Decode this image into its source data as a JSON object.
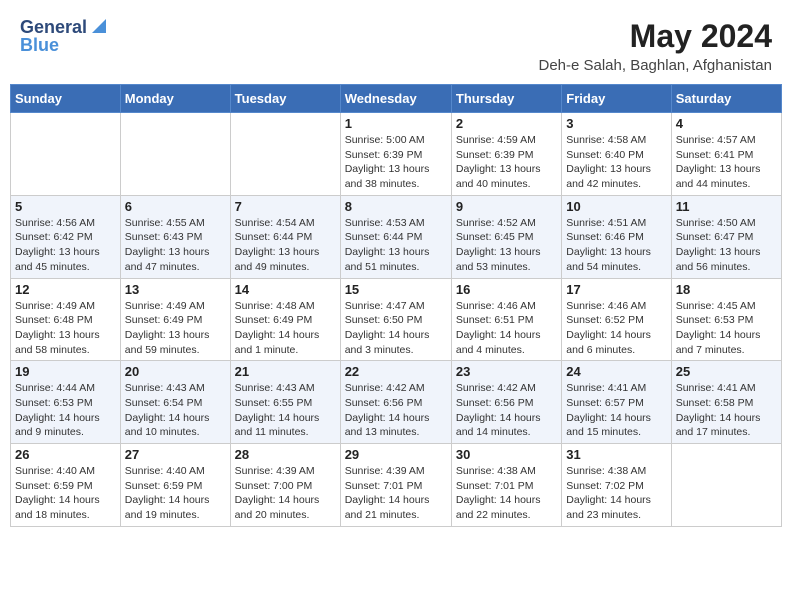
{
  "header": {
    "logo_line1": "General",
    "logo_line2": "Blue",
    "month": "May 2024",
    "location": "Deh-e Salah, Baghlan, Afghanistan"
  },
  "weekdays": [
    "Sunday",
    "Monday",
    "Tuesday",
    "Wednesday",
    "Thursday",
    "Friday",
    "Saturday"
  ],
  "weeks": [
    [
      {
        "day": "",
        "info": ""
      },
      {
        "day": "",
        "info": ""
      },
      {
        "day": "",
        "info": ""
      },
      {
        "day": "1",
        "info": "Sunrise: 5:00 AM\nSunset: 6:39 PM\nDaylight: 13 hours\nand 38 minutes."
      },
      {
        "day": "2",
        "info": "Sunrise: 4:59 AM\nSunset: 6:39 PM\nDaylight: 13 hours\nand 40 minutes."
      },
      {
        "day": "3",
        "info": "Sunrise: 4:58 AM\nSunset: 6:40 PM\nDaylight: 13 hours\nand 42 minutes."
      },
      {
        "day": "4",
        "info": "Sunrise: 4:57 AM\nSunset: 6:41 PM\nDaylight: 13 hours\nand 44 minutes."
      }
    ],
    [
      {
        "day": "5",
        "info": "Sunrise: 4:56 AM\nSunset: 6:42 PM\nDaylight: 13 hours\nand 45 minutes."
      },
      {
        "day": "6",
        "info": "Sunrise: 4:55 AM\nSunset: 6:43 PM\nDaylight: 13 hours\nand 47 minutes."
      },
      {
        "day": "7",
        "info": "Sunrise: 4:54 AM\nSunset: 6:44 PM\nDaylight: 13 hours\nand 49 minutes."
      },
      {
        "day": "8",
        "info": "Sunrise: 4:53 AM\nSunset: 6:44 PM\nDaylight: 13 hours\nand 51 minutes."
      },
      {
        "day": "9",
        "info": "Sunrise: 4:52 AM\nSunset: 6:45 PM\nDaylight: 13 hours\nand 53 minutes."
      },
      {
        "day": "10",
        "info": "Sunrise: 4:51 AM\nSunset: 6:46 PM\nDaylight: 13 hours\nand 54 minutes."
      },
      {
        "day": "11",
        "info": "Sunrise: 4:50 AM\nSunset: 6:47 PM\nDaylight: 13 hours\nand 56 minutes."
      }
    ],
    [
      {
        "day": "12",
        "info": "Sunrise: 4:49 AM\nSunset: 6:48 PM\nDaylight: 13 hours\nand 58 minutes."
      },
      {
        "day": "13",
        "info": "Sunrise: 4:49 AM\nSunset: 6:49 PM\nDaylight: 13 hours\nand 59 minutes."
      },
      {
        "day": "14",
        "info": "Sunrise: 4:48 AM\nSunset: 6:49 PM\nDaylight: 14 hours\nand 1 minute."
      },
      {
        "day": "15",
        "info": "Sunrise: 4:47 AM\nSunset: 6:50 PM\nDaylight: 14 hours\nand 3 minutes."
      },
      {
        "day": "16",
        "info": "Sunrise: 4:46 AM\nSunset: 6:51 PM\nDaylight: 14 hours\nand 4 minutes."
      },
      {
        "day": "17",
        "info": "Sunrise: 4:46 AM\nSunset: 6:52 PM\nDaylight: 14 hours\nand 6 minutes."
      },
      {
        "day": "18",
        "info": "Sunrise: 4:45 AM\nSunset: 6:53 PM\nDaylight: 14 hours\nand 7 minutes."
      }
    ],
    [
      {
        "day": "19",
        "info": "Sunrise: 4:44 AM\nSunset: 6:53 PM\nDaylight: 14 hours\nand 9 minutes."
      },
      {
        "day": "20",
        "info": "Sunrise: 4:43 AM\nSunset: 6:54 PM\nDaylight: 14 hours\nand 10 minutes."
      },
      {
        "day": "21",
        "info": "Sunrise: 4:43 AM\nSunset: 6:55 PM\nDaylight: 14 hours\nand 11 minutes."
      },
      {
        "day": "22",
        "info": "Sunrise: 4:42 AM\nSunset: 6:56 PM\nDaylight: 14 hours\nand 13 minutes."
      },
      {
        "day": "23",
        "info": "Sunrise: 4:42 AM\nSunset: 6:56 PM\nDaylight: 14 hours\nand 14 minutes."
      },
      {
        "day": "24",
        "info": "Sunrise: 4:41 AM\nSunset: 6:57 PM\nDaylight: 14 hours\nand 15 minutes."
      },
      {
        "day": "25",
        "info": "Sunrise: 4:41 AM\nSunset: 6:58 PM\nDaylight: 14 hours\nand 17 minutes."
      }
    ],
    [
      {
        "day": "26",
        "info": "Sunrise: 4:40 AM\nSunset: 6:59 PM\nDaylight: 14 hours\nand 18 minutes."
      },
      {
        "day": "27",
        "info": "Sunrise: 4:40 AM\nSunset: 6:59 PM\nDaylight: 14 hours\nand 19 minutes."
      },
      {
        "day": "28",
        "info": "Sunrise: 4:39 AM\nSunset: 7:00 PM\nDaylight: 14 hours\nand 20 minutes."
      },
      {
        "day": "29",
        "info": "Sunrise: 4:39 AM\nSunset: 7:01 PM\nDaylight: 14 hours\nand 21 minutes."
      },
      {
        "day": "30",
        "info": "Sunrise: 4:38 AM\nSunset: 7:01 PM\nDaylight: 14 hours\nand 22 minutes."
      },
      {
        "day": "31",
        "info": "Sunrise: 4:38 AM\nSunset: 7:02 PM\nDaylight: 14 hours\nand 23 minutes."
      },
      {
        "day": "",
        "info": ""
      }
    ]
  ]
}
